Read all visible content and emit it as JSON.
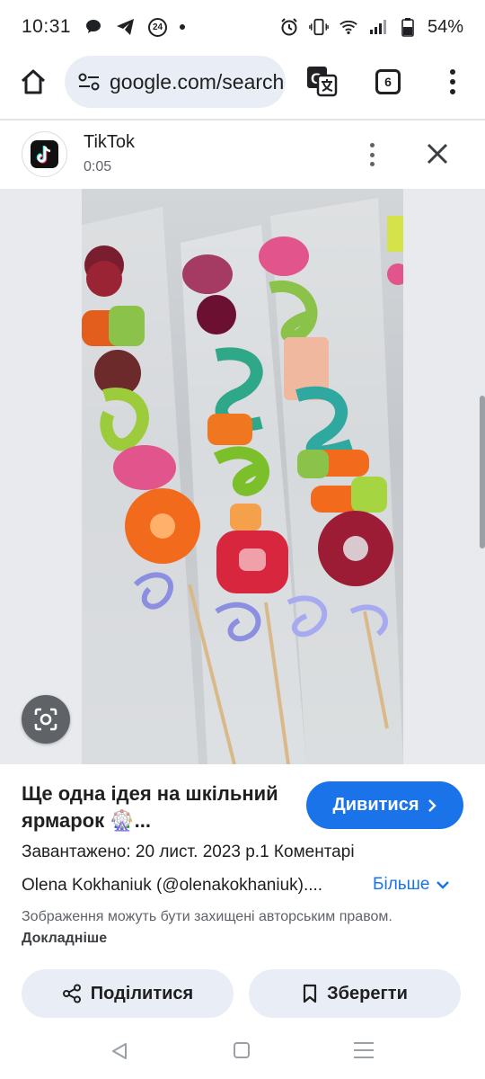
{
  "status_bar": {
    "time": "10:31",
    "notification_badge": "24",
    "battery": "54%",
    "icons": [
      "chat-bubble-icon",
      "telegram-icon",
      "badge-24-icon",
      "dot-icon",
      "alarm-icon",
      "vibrate-icon",
      "wifi-icon",
      "signal-icon",
      "battery-icon"
    ]
  },
  "browser": {
    "url": "google.com/search",
    "tab_count": "6"
  },
  "source": {
    "name": "TikTok",
    "duration": "0:05"
  },
  "result": {
    "title": "Ще одна ідея на шкільний ярмарок 🎡...",
    "visit_label": "Дивитися",
    "meta": "Завантажено: 20 лист. 2023 р.1 Коментарі",
    "author": "Olena Kokhaniuk (@olenakokhaniuk)....",
    "more_label": "Більше",
    "copyright_text": "Зображення можуть бути захищені авторським правом.",
    "copyright_link": "Докладніше",
    "share_label": "Поділитися",
    "save_label": "Зберегти"
  },
  "colors": {
    "accent": "#1a73e8",
    "pill_bg": "#e9eef6",
    "image_bg": "#e8eaed"
  }
}
